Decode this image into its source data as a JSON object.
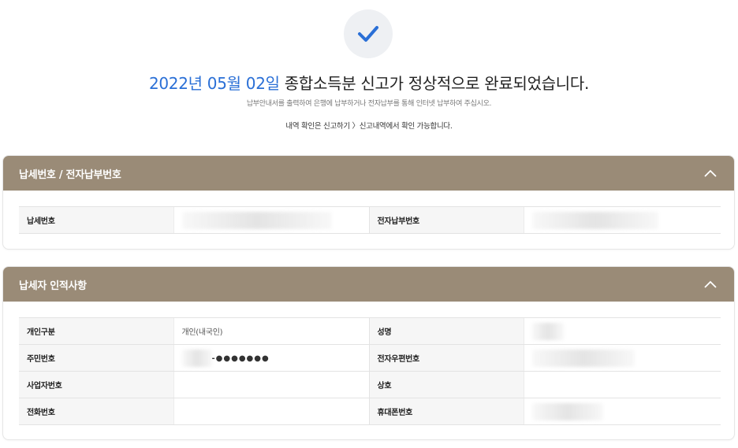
{
  "result": {
    "headline_date": "2022년 05월 02일",
    "headline_rest": " 종합소득분 신고가 정상적으로 완료되었습니다.",
    "sub_notice": "납부안내서를 출력하여 은행에 납부하거나 전자납부를 통해 인터넷 납부하여 주십시오.",
    "history_notice": "내역 확인은 신고하기 〉신고내역에서 확인 가능합니다."
  },
  "payment_panel": {
    "title": "납세번호 / 전자납부번호",
    "rows": [
      {
        "label1": "납세번호",
        "value1": "",
        "label2": "전자납부번호",
        "value2": ""
      }
    ]
  },
  "taxpayer_panel": {
    "title": "납세자 인적사항",
    "rows": [
      {
        "label1": "개인구분",
        "value1": "개인(내국인)",
        "label2": "성명",
        "value2": ""
      },
      {
        "label1": "주민번호",
        "value1": "-●●●●●●●",
        "label2": "전자우편번호",
        "value2": ""
      },
      {
        "label1": "사업자번호",
        "value1": "",
        "label2": "상호",
        "value2": ""
      },
      {
        "label1": "전화번호",
        "value1": "",
        "label2": "휴대폰번호",
        "value2": ""
      }
    ]
  },
  "colors": {
    "accent_blue": "#2a6fd6",
    "panel_header": "#9a8b77"
  },
  "icons": {
    "status": "check-icon",
    "collapse": "chevron-up-icon"
  }
}
